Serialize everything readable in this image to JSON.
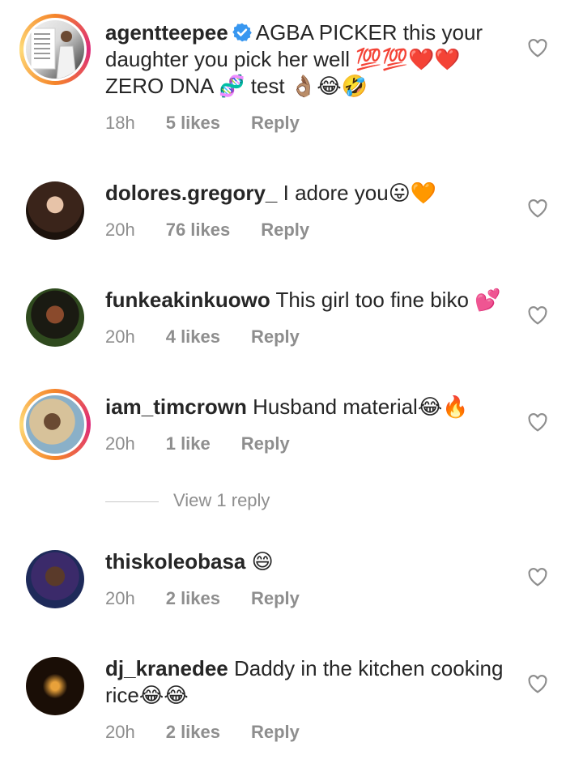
{
  "comments": [
    {
      "username": "agentteepee",
      "text": "AGBA PICKER this your daughter you pick her well 💯💯❤️❤️ ZERO DNA 🧬 test 👌🏽😂🤣",
      "time": "18h",
      "likes": "5 likes",
      "reply": "Reply",
      "verified": true,
      "story_ring": true
    },
    {
      "username": "dolores.gregory_",
      "text": "I adore you😛🧡",
      "time": "20h",
      "likes": "76 likes",
      "reply": "Reply",
      "story_ring": false
    },
    {
      "username": "funkeakinkuowo",
      "text": "This girl too fine biko 💕",
      "time": "20h",
      "likes": "4 likes",
      "reply": "Reply",
      "story_ring": false
    },
    {
      "username": "iam_timcrown",
      "text": "Husband material😂🔥",
      "time": "20h",
      "likes": "1 like",
      "reply": "Reply",
      "story_ring": true
    },
    {
      "username": "thiskoleobasa",
      "text": "😄",
      "time": "20h",
      "likes": "2 likes",
      "reply": "Reply",
      "story_ring": false
    },
    {
      "username": "dj_kranedee",
      "text": "Daddy in the kitchen cooking rice😂😂",
      "time": "20h",
      "likes": "2 likes",
      "reply": "Reply",
      "story_ring": false
    }
  ],
  "view_replies_label": "View 1 reply",
  "icons": {
    "like": "heart-outline-icon",
    "verified": "verified-badge-icon"
  },
  "colors": {
    "verified_blue": "#3897f0",
    "meta_gray": "#8e8e8e",
    "text": "#262626"
  }
}
